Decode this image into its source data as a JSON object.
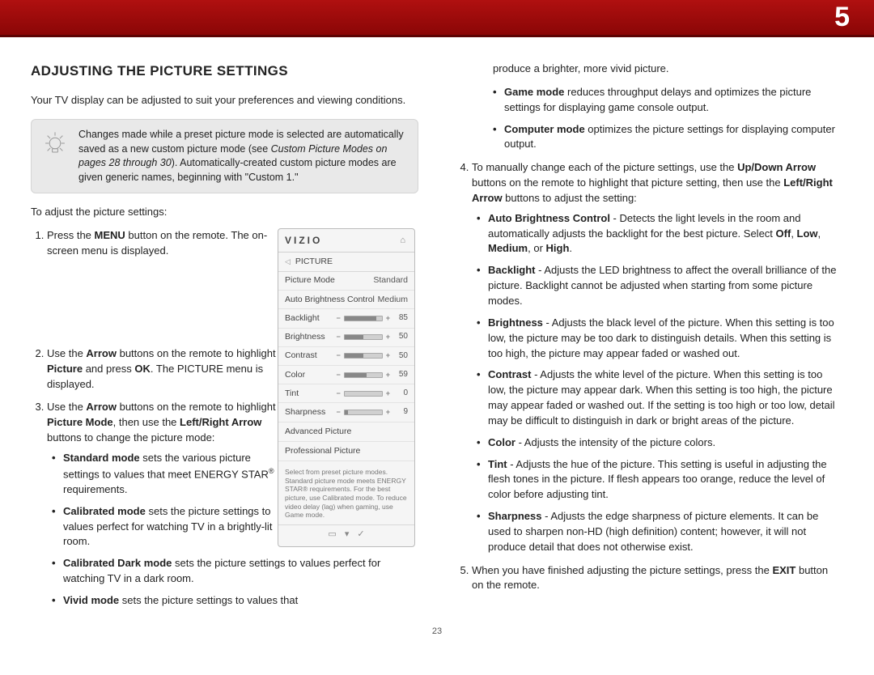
{
  "chapter": "5",
  "page_number": "23",
  "heading": "ADJUSTING THE PICTURE SETTINGS",
  "intro": "Your TV display can be adjusted to suit your preferences and viewing conditions.",
  "tip": {
    "text_before_ref": "Changes made while a preset picture mode is selected are automatically saved as a new custom picture mode (see ",
    "ref": "Custom Picture Modes on pages 28 through 30",
    "text_after_ref": "). Automatically-created custom picture modes are given generic names, beginning with \"Custom 1.\""
  },
  "lead": "To adjust the picture settings:",
  "step1": {
    "p1": "Press the ",
    "b1": "MENU",
    "p2": " button on the remote. The on-screen menu is displayed."
  },
  "step2": {
    "p1": "Use the ",
    "b1": "Arrow",
    "p2": " buttons on the remote to highlight ",
    "b2": "Picture",
    "p3": " and press ",
    "b3": "OK",
    "p4": ". The PICTURE menu is displayed."
  },
  "step3": {
    "p1": "Use the ",
    "b1": "Arrow",
    "p2": " buttons on the remote to highlight ",
    "b2": "Picture Mode",
    "p3": ", then use the ",
    "b3": "Left/Right Arrow",
    "p4": " buttons to change the picture mode:"
  },
  "modes1": {
    "standard": {
      "b": "Standard mode",
      "t": " sets the various picture settings to values that meet ENERGY STAR",
      "sup": "®",
      "t2": " requirements."
    },
    "calibrated": {
      "b": "Calibrated mode",
      "t": " sets the picture settings to values perfect for watching TV in a brightly-lit room."
    },
    "calibrated_dark": {
      "b": "Calibrated Dark mode",
      "t": " sets the picture settings to values perfect for watching TV in a dark room."
    },
    "vivid": {
      "b": "Vivid mode",
      "t": " sets the picture settings to values that"
    }
  },
  "col2_cont": "produce a brighter, more vivid picture.",
  "modes2": {
    "game": {
      "b": "Game mode",
      "t": " reduces throughput delays and optimizes the picture settings for displaying game console output."
    },
    "computer": {
      "b": "Computer mode",
      "t": " optimizes the picture settings for displaying computer output."
    }
  },
  "step4": {
    "p1": "To manually change each of the picture settings, use the ",
    "b1": "Up/Down Arrow",
    "p2": " buttons on the remote to highlight that picture setting, then use the ",
    "b2": "Left/Right Arrow",
    "p3": " buttons to adjust the setting:"
  },
  "settings": {
    "abc": {
      "b": "Auto Brightness Control",
      "t": " - Detects the light levels in the room and automatically adjusts the backlight for the best picture. Select ",
      "o1": "Off",
      "c1": ", ",
      "o2": "Low",
      "c2": ", ",
      "o3": "Medium",
      "c3": ", or ",
      "o4": "High",
      "end": "."
    },
    "backlight": {
      "b": "Backlight",
      "t": " - Adjusts the LED brightness to affect the overall brilliance of the picture. Backlight cannot be adjusted when starting from some picture modes."
    },
    "brightness": {
      "b": "Brightness",
      "t": " - Adjusts the black level of the picture. When this setting is too low, the picture may be too dark to distinguish details. When this setting is too high, the picture may appear faded or washed out."
    },
    "contrast": {
      "b": "Contrast",
      "t": " - Adjusts the white level of the picture. When this setting is too low, the picture may appear dark. When this setting is too high, the picture may appear faded or washed out. If the setting is too high or too low, detail may be difficult to distinguish in dark or bright areas of the picture."
    },
    "color": {
      "b": "Color",
      "t": " - Adjusts the intensity of the picture colors."
    },
    "tint": {
      "b": "Tint",
      "t": " - Adjusts the hue of the picture. This setting is useful in adjusting the flesh tones in the picture. If flesh appears too orange, reduce the level of color before adjusting tint."
    },
    "sharpness": {
      "b": "Sharpness",
      "t": " - Adjusts the edge sharpness of picture elements. It can be used to sharpen non-HD (high definition) content; however, it will not produce detail that does not otherwise exist."
    }
  },
  "step5": {
    "p1": "When you have finished adjusting the picture settings, press the ",
    "b1": "EXIT",
    "p2": " button on the remote."
  },
  "menu": {
    "brand": "VIZIO",
    "section": "PICTURE",
    "picture_mode_label": "Picture Mode",
    "picture_mode_value": "Standard",
    "abc_label": "Auto Brightness Control",
    "abc_value": "Medium",
    "rows": [
      {
        "label": "Backlight",
        "value": 85
      },
      {
        "label": "Brightness",
        "value": 50
      },
      {
        "label": "Contrast",
        "value": 50
      },
      {
        "label": "Color",
        "value": 59
      },
      {
        "label": "Tint",
        "value": 0
      },
      {
        "label": "Sharpness",
        "value": 9
      }
    ],
    "adv": "Advanced Picture",
    "prof": "Professional Picture",
    "hint": "Select from preset picture modes. Standard picture mode meets ENERGY STAR® requirements. For the best picture, use Calibrated mode. To reduce video delay (lag) when gaming, use Game mode."
  }
}
